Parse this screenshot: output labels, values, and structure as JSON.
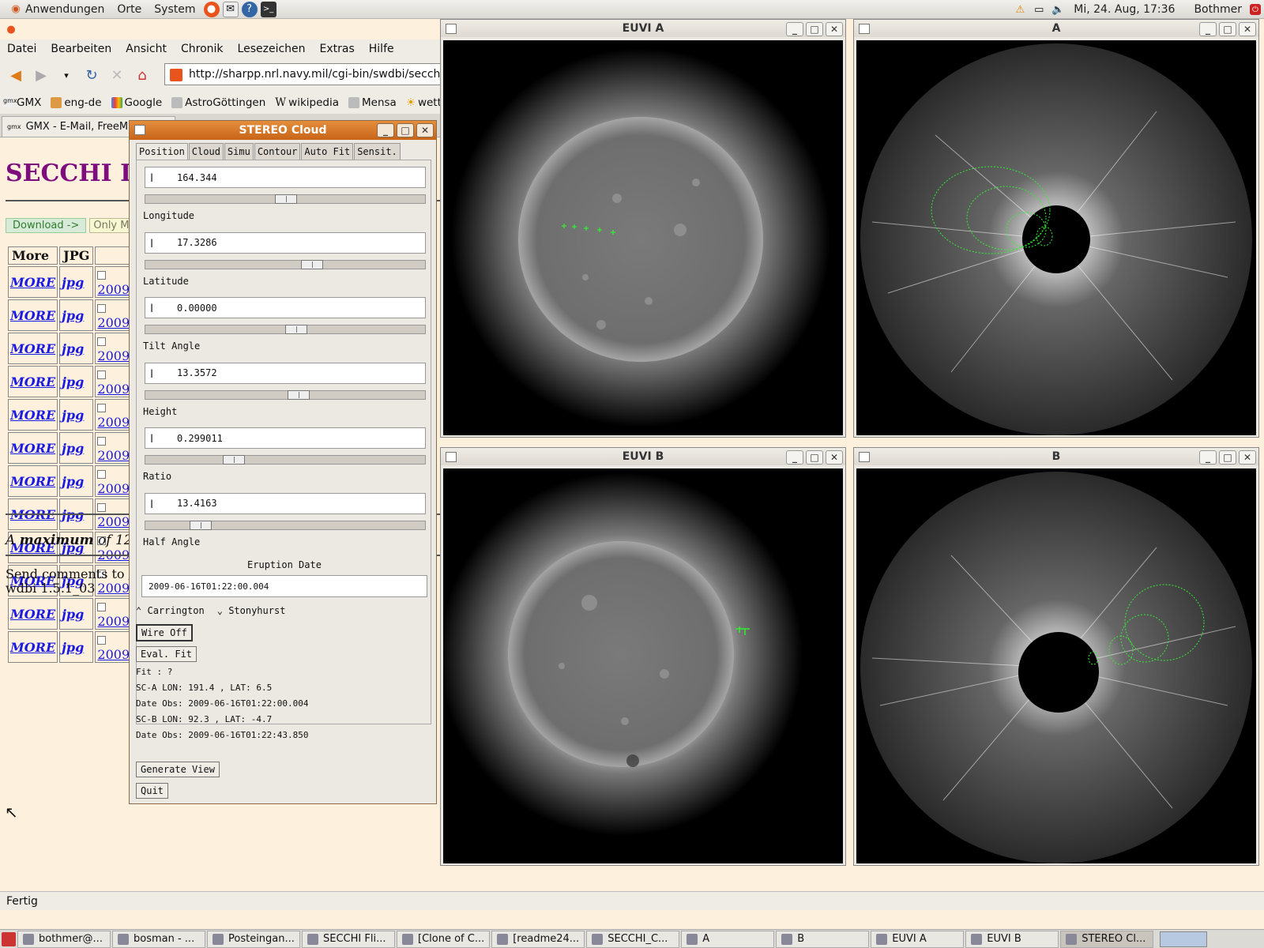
{
  "top_panel": {
    "menus": [
      "Anwendungen",
      "Orte",
      "System"
    ],
    "datetime": "Mi, 24. Aug, 17:36",
    "user": "Bothmer"
  },
  "browser": {
    "menu": [
      "Datei",
      "Bearbeiten",
      "Ansicht",
      "Chronik",
      "Lesezeichen",
      "Extras",
      "Hilfe"
    ],
    "url": "http://sharpp.nrl.navy.mil/cgi-bin/swdbi/secchi_fligh",
    "bookmarks": [
      "GMX",
      "eng-de",
      "Google",
      "AstroGöttingen",
      "wikipedia",
      "Mensa",
      "wetter"
    ],
    "tab_title": "GMX - E-Mail, FreeMail",
    "page": {
      "title": "SECCHI I",
      "download_label": "Download  ->",
      "only_label": "Only Ma",
      "col_more": "More",
      "col_jpg": "JPG",
      "rows": [
        {
          "more": "MORE",
          "jpg": "jpg",
          "date": "20090"
        },
        {
          "more": "MORE",
          "jpg": "jpg",
          "date": "20090"
        },
        {
          "more": "MORE",
          "jpg": "jpg",
          "date": "20090"
        },
        {
          "more": "MORE",
          "jpg": "jpg",
          "date": "20090"
        },
        {
          "more": "MORE",
          "jpg": "jpg",
          "date": "20090"
        },
        {
          "more": "MORE",
          "jpg": "jpg",
          "date": "20090"
        },
        {
          "more": "MORE",
          "jpg": "jpg",
          "date": "20090"
        },
        {
          "more": "MORE",
          "jpg": "jpg",
          "date": "20090"
        },
        {
          "more": "MORE",
          "jpg": "jpg",
          "date": "20090"
        },
        {
          "more": "MORE",
          "jpg": "jpg",
          "date": "20090"
        },
        {
          "more": "MORE",
          "jpg": "jpg",
          "date": "20090"
        },
        {
          "more": "MORE",
          "jpg": "jpg",
          "date": "20090"
        }
      ],
      "max_note_a": "A ",
      "max_note_b": "maximum",
      "max_note_c": " of 12 v",
      "comments": "Send comments to",
      "comments_link": "c",
      "version": "wdbi 1.5.1_03"
    },
    "status": "Fertig"
  },
  "cloud": {
    "title": "STEREO Cloud",
    "tabs": [
      "Position",
      "Cloud",
      "Simu",
      "Contour",
      "Auto Fit",
      "Sensit."
    ],
    "fields": [
      {
        "label": "Longitude",
        "value": "164.344",
        "slider": 0.5
      },
      {
        "label": "Latitude",
        "value": "17.3286",
        "slider": 0.6
      },
      {
        "label": "Tilt Angle",
        "value": "0.00000",
        "slider": 0.54
      },
      {
        "label": "Height",
        "value": "13.3572",
        "slider": 0.55
      },
      {
        "label": "Ratio",
        "value": "0.299011",
        "slider": 0.3
      },
      {
        "label": "Half Angle",
        "value": "13.4163",
        "slider": 0.17
      }
    ],
    "eruption_label": "Eruption Date",
    "eruption_value": "2009-06-16T01:22:00.004",
    "radio_carrington": "Carrington",
    "radio_stonyhurst": "Stonyhurst",
    "wire_btn": "Wire Off",
    "eval_btn": "Eval. Fit",
    "fit": "Fit : ?",
    "sca": "SC-A LON:  191.4 , LAT:   6.5",
    "date_a": "Date Obs: 2009-06-16T01:22:00.004",
    "scb": "SC-B LON:   92.3 , LAT:  -4.7",
    "date_b": "Date Obs: 2009-06-16T01:22:43.850",
    "generate_btn": "Generate View",
    "quit_btn": "Quit"
  },
  "windows": {
    "euvi_a": "EUVI A",
    "cor_a": "A",
    "euvi_b": "EUVI B",
    "cor_b": "B"
  },
  "taskbar": [
    "bothmer@...",
    "bosman - ...",
    "Posteingan...",
    "SECCHI Fli...",
    "[Clone of C...",
    "[readme24...",
    "SECCHI_C...",
    "A",
    "B",
    "EUVI A",
    "EUVI B",
    "STEREO Cl..."
  ],
  "colors": {
    "accent": "#c86418",
    "wireframe": "#33ee33",
    "title_purple": "#7d0d7d"
  }
}
